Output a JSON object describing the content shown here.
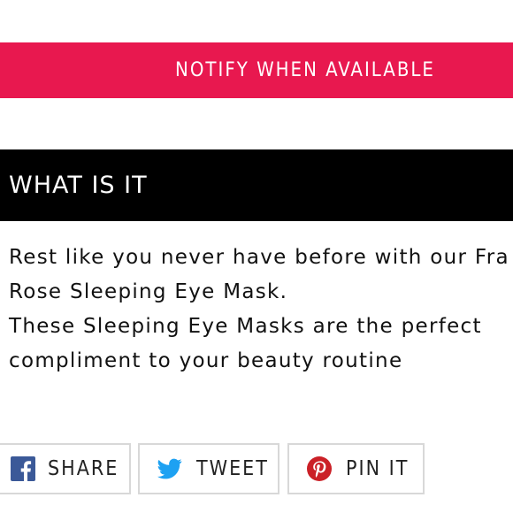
{
  "notify": {
    "label": "NOTIFY WHEN AVAILABLE",
    "color": "#e8184f"
  },
  "section": {
    "title": "WHAT IS IT"
  },
  "description": {
    "lines": [
      "Rest like you never have before with our Fra",
      "Rose Sleeping Eye Mask.",
      "These Sleeping Eye Masks are the perfect",
      "compliment to your beauty routine"
    ]
  },
  "share": {
    "buttons": [
      {
        "label": "SHARE",
        "icon": "facebook-icon",
        "color": "#3b5998"
      },
      {
        "label": "TWEET",
        "icon": "twitter-icon",
        "color": "#1da1f2"
      },
      {
        "label": "PIN IT",
        "icon": "pinterest-icon",
        "color": "#cb2027"
      }
    ]
  }
}
